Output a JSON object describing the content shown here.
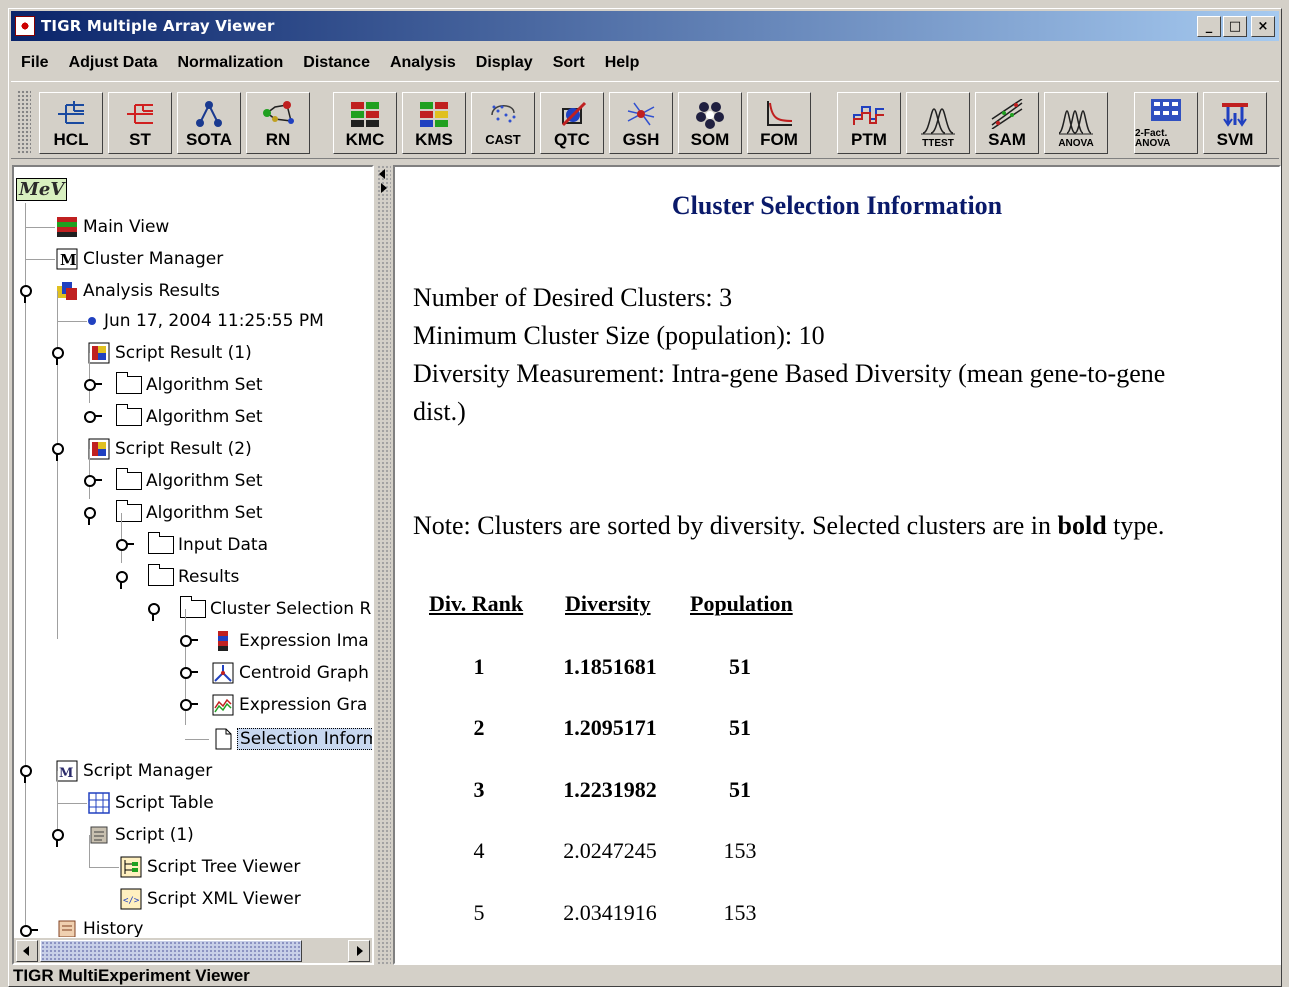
{
  "window": {
    "title": "TIGR Multiple Array Viewer",
    "min_label": "_",
    "max_label": "□",
    "close_label": "×"
  },
  "menu": [
    "File",
    "Adjust Data",
    "Normalization",
    "Distance",
    "Analysis",
    "Display",
    "Sort",
    "Help"
  ],
  "toolbar": [
    {
      "label": "HCL",
      "icon": "hcl-icon"
    },
    {
      "label": "ST",
      "icon": "st-icon"
    },
    {
      "label": "SOTA",
      "icon": "sota-icon"
    },
    {
      "label": "RN",
      "icon": "rn-icon"
    },
    {
      "label": "KMC",
      "icon": "kmc-icon"
    },
    {
      "label": "KMS",
      "icon": "kms-icon"
    },
    {
      "label": "CAST",
      "icon": "cast-icon"
    },
    {
      "label": "QTC",
      "icon": "qtc-icon"
    },
    {
      "label": "GSH",
      "icon": "gsh-icon"
    },
    {
      "label": "SOM",
      "icon": "som-icon"
    },
    {
      "label": "FOM",
      "icon": "fom-icon"
    },
    {
      "label": "PTM",
      "icon": "ptm-icon"
    },
    {
      "label": "TTEST",
      "icon": "ttest-icon"
    },
    {
      "label": "SAM",
      "icon": "sam-icon"
    },
    {
      "label": "ANOVA",
      "icon": "anova-icon"
    },
    {
      "label": "2-Fact. ANOVA",
      "icon": "two-factor-anova-icon"
    },
    {
      "label": "SVM",
      "icon": "svm-icon"
    }
  ],
  "tree": {
    "root_logo": "MeV",
    "nodes": [
      "Main View",
      "Cluster Manager",
      "Analysis Results",
      "Jun 17, 2004 11:25:55 PM",
      "Script Result (1)",
      "Algorithm Set",
      "Algorithm Set",
      "Script Result (2)",
      "Algorithm Set",
      "Algorithm Set",
      "Input Data",
      "Results",
      "Cluster Selection R",
      "Expression Ima",
      "Centroid Graph",
      "Expression Gra",
      "Selection Inform",
      "Script Manager",
      "Script Table",
      "Script (1)",
      "Script Tree Viewer",
      "Script XML Viewer",
      "History"
    ]
  },
  "info": {
    "title": "Cluster Selection Information",
    "desired_clusters": "Number of Desired Clusters: 3",
    "min_cluster_size": "Minimum Cluster Size (population): 10",
    "diversity_measure_1": "Diversity Measurement: Intra-gene Based Diversity (mean gene-to-gene",
    "diversity_measure_2": "dist.)",
    "note_prefix": "Note: Clusters are sorted by diversity. Selected clusters are in ",
    "note_bold": "bold",
    "note_suffix": " type.",
    "columns": [
      "Div. Rank",
      "Diversity",
      "Population"
    ],
    "rows": [
      {
        "rank": "1",
        "diversity": "1.1851681",
        "population": "51",
        "selected": true
      },
      {
        "rank": "2",
        "diversity": "1.2095171",
        "population": "51",
        "selected": true
      },
      {
        "rank": "3",
        "diversity": "1.2231982",
        "population": "51",
        "selected": true
      },
      {
        "rank": "4",
        "diversity": "2.0247245",
        "population": "153",
        "selected": false
      },
      {
        "rank": "5",
        "diversity": "2.0341916",
        "population": "153",
        "selected": false
      }
    ]
  },
  "status": "TIGR MultiExperiment Viewer"
}
